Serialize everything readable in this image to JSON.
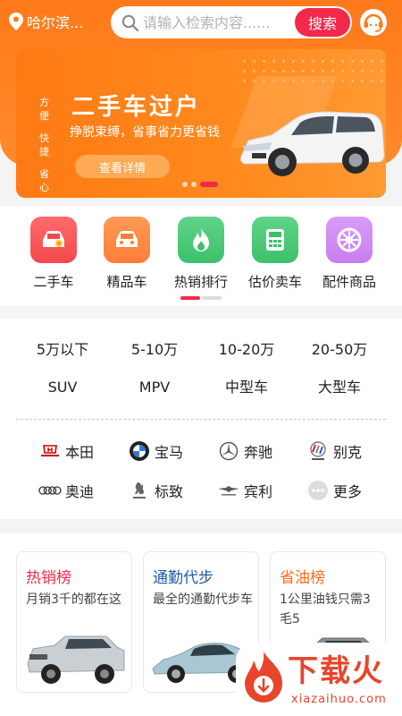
{
  "header": {
    "city": "哈尔滨...",
    "search_placeholder": "请输入检索内容......",
    "search_button": "搜索"
  },
  "banner": {
    "side_tags": [
      "方便",
      "快捷",
      "省心"
    ],
    "title": "二手车过户",
    "subtitle": "挣脱束缚，省事省力更省钱",
    "cta": "查看详情",
    "slide_count": 3,
    "active_slide": 3
  },
  "categories": [
    {
      "label": "二手车",
      "color": "#f2494c",
      "icon": "used-car-icon"
    },
    {
      "label": "精品车",
      "color": "#ff7d3a",
      "icon": "premium-car-icon"
    },
    {
      "label": "热销排行",
      "color": "#3dc06c",
      "icon": "flame-icon"
    },
    {
      "label": "估价卖车",
      "color": "#3dc06c",
      "icon": "calculator-icon"
    },
    {
      "label": "配件商品",
      "color": "#c77df0",
      "icon": "wheel-icon"
    }
  ],
  "price_filters": [
    "5万以下",
    "5-10万",
    "10-20万",
    "20-50万"
  ],
  "type_filters": [
    "SUV",
    "MPV",
    "中型车",
    "大型车"
  ],
  "brands": [
    {
      "name": "本田",
      "icon": "honda-logo-icon"
    },
    {
      "name": "宝马",
      "icon": "bmw-logo-icon"
    },
    {
      "name": "奔驰",
      "icon": "mercedes-logo-icon"
    },
    {
      "name": "别克",
      "icon": "buick-logo-icon"
    },
    {
      "name": "奥迪",
      "icon": "audi-logo-icon"
    },
    {
      "name": "标致",
      "icon": "peugeot-logo-icon"
    },
    {
      "name": "宾利",
      "icon": "bentley-logo-icon"
    },
    {
      "name": "更多",
      "icon": "more-dots-icon"
    }
  ],
  "rankings": [
    {
      "title": "热销榜",
      "desc": "月销3千的都在这",
      "color": "#f2294a"
    },
    {
      "title": "通勤代步",
      "desc": "最全的通勤代步车",
      "color": "#1f5aa8"
    },
    {
      "title": "省油榜",
      "desc": "1公里油钱只需3毛5",
      "color": "#ff6a1a"
    }
  ],
  "watermark": {
    "text": "下载火",
    "sub": "xiazaihuo.com"
  }
}
